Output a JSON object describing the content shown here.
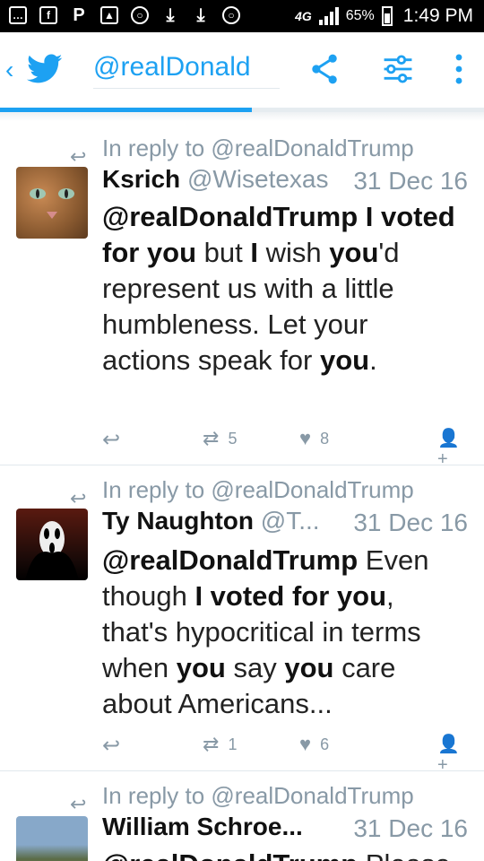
{
  "status_bar": {
    "network": "4G",
    "battery": "65%",
    "time": "1:49 PM"
  },
  "header": {
    "title": "@realDonald",
    "progress": 0.52
  },
  "tweets": [
    {
      "reply_context": "In reply to @realDonaldTrump",
      "name": "Ksrich",
      "handle": "@Wisetexas",
      "date": "31 Dec 16",
      "text": [
        {
          "t": "@realDonaldTrump I voted for you",
          "b": true
        },
        {
          "t": " but ",
          "b": false
        },
        {
          "t": "I",
          "b": true
        },
        {
          "t": " wish ",
          "b": false
        },
        {
          "t": "you",
          "b": true
        },
        {
          "t": "'d represent us with a little humbleness. Let your actions speak for ",
          "b": false
        },
        {
          "t": "you",
          "b": true
        },
        {
          "t": ".",
          "b": false
        }
      ],
      "retweets": "5",
      "likes": "8"
    },
    {
      "reply_context": "In reply to @realDonaldTrump",
      "name": "Ty Naughton",
      "handle": "@T...",
      "date": "31 Dec 16",
      "text": [
        {
          "t": "@realDonaldTrump",
          "b": true
        },
        {
          "t": " Even though ",
          "b": false
        },
        {
          "t": "I voted for you",
          "b": true
        },
        {
          "t": ", that's hypocritical in terms when ",
          "b": false
        },
        {
          "t": "you",
          "b": true
        },
        {
          "t": " say ",
          "b": false
        },
        {
          "t": "you",
          "b": true
        },
        {
          "t": " care about Americans...",
          "b": false
        }
      ],
      "retweets": "1",
      "likes": "6"
    },
    {
      "reply_context": "In reply to @realDonaldTrump",
      "name": "William Schroe...",
      "handle": "",
      "date": "31 Dec 16",
      "text": [
        {
          "t": "@realDonaldTrump",
          "b": true
        },
        {
          "t": " Please",
          "b": false
        }
      ]
    }
  ]
}
